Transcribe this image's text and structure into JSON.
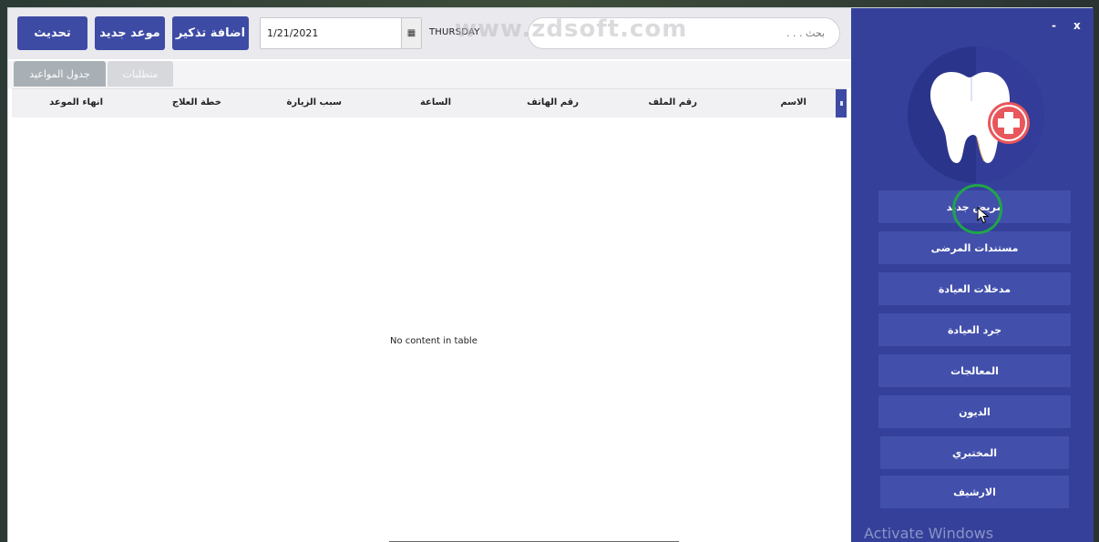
{
  "toolbar": {
    "refresh_label": "تحديث",
    "new_appointment_label": "موعد جديد",
    "add_reminder_label": "اضافة تذكير",
    "date_value": "1/21/2021",
    "day_label": "THURSDAY",
    "search_placeholder": "بحث . . .",
    "watermark": "www.zdsoft.com"
  },
  "tabs": [
    {
      "label": "جدول المواعيد"
    },
    {
      "label": "متطلبات"
    }
  ],
  "table": {
    "columns": [
      "الاسم",
      "رقم الملف",
      "رقم الهاتف",
      "الساعة",
      "سبب الزيارة",
      "خطة العلاج",
      "انهاء الموعد"
    ],
    "empty_message": "No content in table"
  },
  "sidebar": {
    "minimize_label": "-",
    "close_label": "x",
    "items": [
      {
        "label": "مريض جديد"
      },
      {
        "label": "مستندات المرضى"
      },
      {
        "label": "مدخلات العيادة"
      },
      {
        "label": "جرد العيادة"
      },
      {
        "label": "المعالجات"
      },
      {
        "label": "الديون"
      },
      {
        "label": "المختبري"
      },
      {
        "label": "الارشيف"
      }
    ]
  },
  "overlay": {
    "activate_windows": "Activate Windows"
  },
  "colors": {
    "accent": "#3d4ba4",
    "sidebar_bg": "#34409a",
    "sidebar_button": "#4250ab",
    "highlight_ring": "#1fa54a",
    "logo_cross": "#e8575b"
  }
}
